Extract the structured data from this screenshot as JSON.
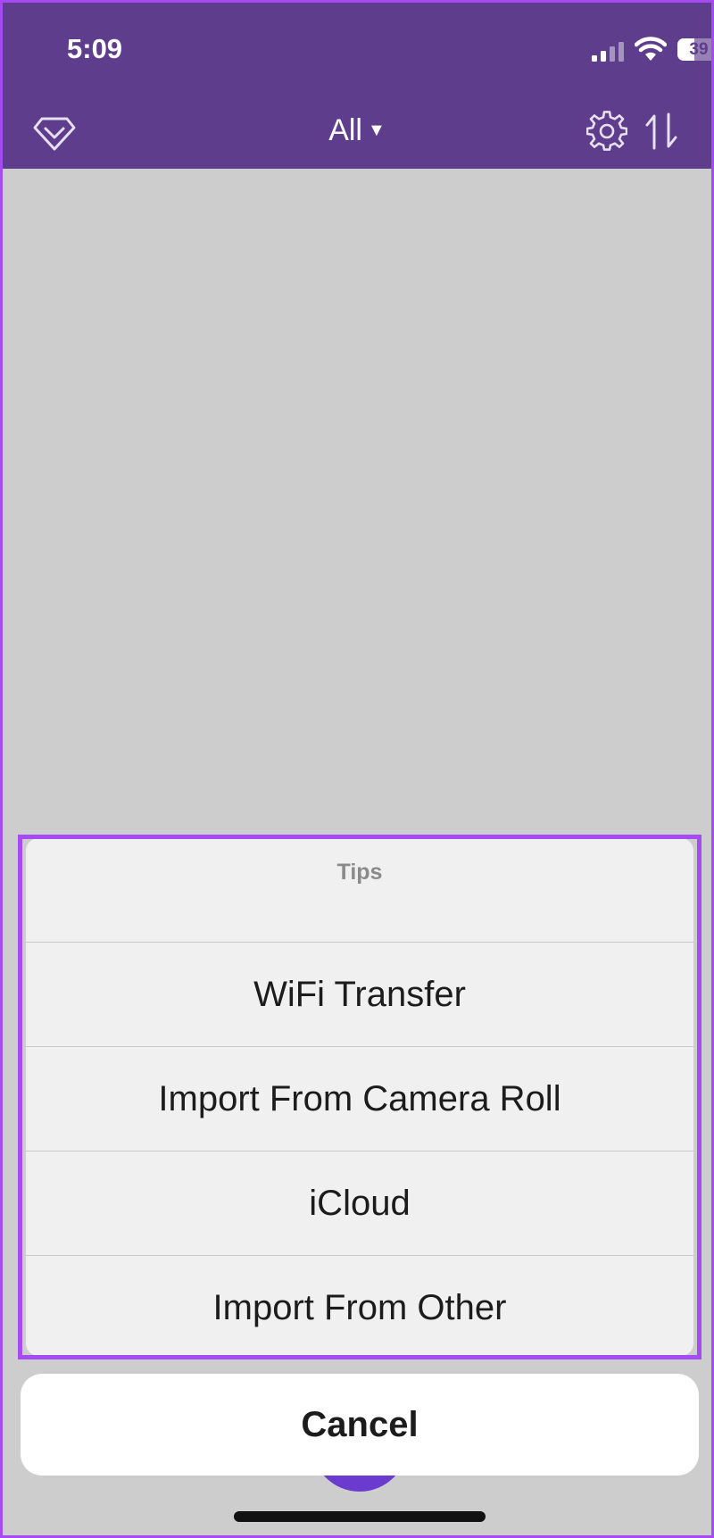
{
  "status_bar": {
    "time": "5:09",
    "battery_percent": "39",
    "battery_level": 0.39,
    "icons": [
      "signal-icon",
      "wifi-icon",
      "battery-icon"
    ]
  },
  "nav": {
    "filter_label": "All",
    "left_icon": "premium-diamond-icon",
    "right_icons": [
      "gear-icon",
      "sort-icon"
    ],
    "background": "#5e3d8d"
  },
  "action_sheet": {
    "title": "Tips",
    "items": [
      {
        "label": "WiFi Transfer"
      },
      {
        "label": "Import From Camera Roll"
      },
      {
        "label": "iCloud"
      },
      {
        "label": "Import From Other"
      }
    ],
    "cancel_label": "Cancel",
    "highlight_color": "#a64bf4"
  },
  "theme": {
    "backdrop": "#cdcdcd",
    "sheet_background": "#f0f0f0",
    "fab_color": "#6b3bd0"
  }
}
